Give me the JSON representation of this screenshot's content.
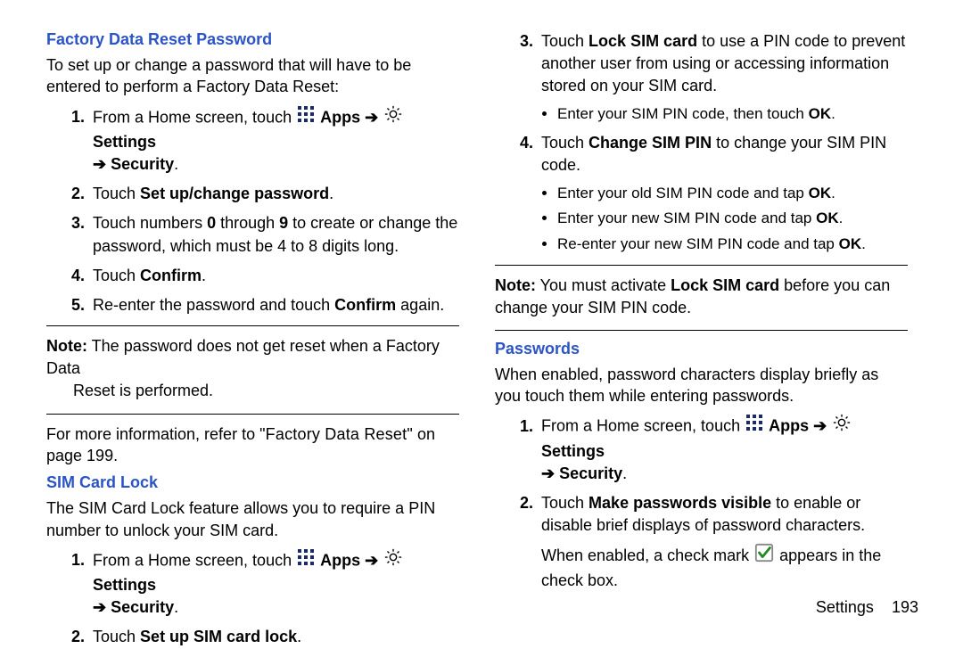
{
  "left": {
    "h_fdrp": "Factory Data Reset Password",
    "p_fdrp_intro": "To set up or change a password that will have to be entered to perform a Factory Data Reset:",
    "step1_pre": "From a Home screen, touch ",
    "apps": "Apps",
    "arrow": "➔",
    "settings": "Settings",
    "security_path": "➔ Security",
    "step2_pre": "Touch ",
    "step2_b": "Set up/change password",
    "step3_a": "Touch numbers ",
    "step3_b0": "0",
    "step3_mid": " through ",
    "step3_b9": "9",
    "step3_c": " to create or change the password, which must be 4 to 8 digits long.",
    "step4_pre": "Touch ",
    "step4_b": "Confirm",
    "step5_a": "Re-enter the password and touch ",
    "step5_b": "Confirm",
    "step5_c": " again.",
    "note_label": "Note:",
    "note_body1": " The password does not get reset when a Factory Data",
    "note_body2": "Reset is performed.",
    "xref_a": "For more information, refer to ",
    "xref_title": "\"Factory Data Reset\"",
    "xref_on": " on ",
    "xref_page": "page 199.",
    "h_sim": "SIM Card Lock",
    "p_sim_intro": "The SIM Card Lock feature allows you to require a PIN number to unlock your SIM card.",
    "sim_step2_pre": "Touch ",
    "sim_step2_b": "Set up SIM card lock"
  },
  "right": {
    "step3_a": "Touch ",
    "step3_b": "Lock SIM card",
    "step3_c": " to use a PIN code to prevent another user from using or accessing information stored on your SIM card.",
    "sub1_a": "Enter your SIM PIN code, then touch ",
    "ok": "OK",
    "step4_a": "Touch ",
    "step4_b": "Change SIM PIN",
    "step4_c": " to change your SIM PIN code.",
    "sub2": "Enter your old SIM PIN code and tap ",
    "sub3": "Enter your new SIM PIN code and tap ",
    "sub4": "Re-enter your new SIM PIN code and tap ",
    "note_label": "Note:",
    "note_body1": " You must activate ",
    "note_b": "Lock SIM card",
    "note_body2": " before you can change your SIM PIN code.",
    "h_pw": "Passwords",
    "p_pw_intro": "When enabled, password characters display briefly as you touch them while entering passwords.",
    "pw_step2_a": "Touch ",
    "pw_step2_b": "Make passwords visible",
    "pw_step2_c": " to enable or disable brief displays of password characters.",
    "pw_after_a": "When enabled, a check mark ",
    "pw_after_b": " appears in the check box."
  },
  "footer": {
    "section": "Settings",
    "page": "193"
  }
}
